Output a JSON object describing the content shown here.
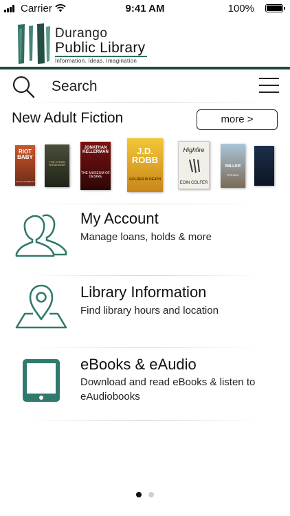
{
  "status_bar": {
    "carrier": "Carrier",
    "time": "9:41 AM",
    "battery_percent": "100%"
  },
  "header": {
    "logo_line1": "Durango",
    "logo_line2": "Public Library",
    "logo_tagline": "Information. Ideas. Imagination",
    "brand_color": "#2f6f62"
  },
  "search": {
    "label": "Search",
    "icon": "search-icon",
    "menu_icon": "hamburger-menu-icon"
  },
  "new_fiction": {
    "title": "New Adult Fiction",
    "more_label": "more >",
    "books": [
      {
        "cover_text": "RIOT BABY",
        "author_text": "TOCHI ONYEBUCHI"
      },
      {
        "cover_text": "THE OTHER PASSENGER",
        "author_text": ""
      },
      {
        "cover_text": "THE MUSEUM OF DESIRE",
        "author_text": "JONATHAN KELLERMAN"
      },
      {
        "cover_text": "GOLDEN IN DEATH",
        "author_text": "J.D. ROBB"
      },
      {
        "cover_text": "Highfire",
        "author_text": "EOIN COLFER"
      },
      {
        "cover_text": "STRONG",
        "author_text": "MILLER"
      },
      {
        "cover_text": "",
        "author_text": ""
      }
    ]
  },
  "menu_items": [
    {
      "title": "My Account",
      "subtitle": "Manage loans, holds & more",
      "icon": "user-account-icon"
    },
    {
      "title": "Library Information",
      "subtitle": "Find library hours and location",
      "icon": "map-pin-icon"
    },
    {
      "title": "eBooks & eAudio",
      "subtitle": "Download and read eBooks & listen to eAudiobooks",
      "icon": "tablet-icon"
    }
  ],
  "pager": {
    "pages": 2,
    "active": 1
  },
  "colors": {
    "accent": "#2f7a6d",
    "dark_rule": "#1f4a42",
    "dot_active": "#111111",
    "dot_inactive": "#cfcfcf"
  }
}
